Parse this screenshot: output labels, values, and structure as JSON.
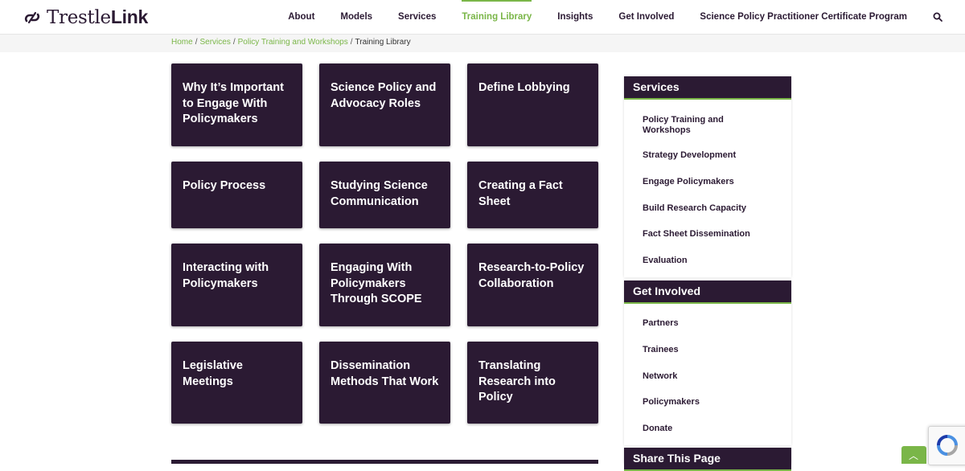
{
  "header": {
    "logo_light": "Trestle",
    "logo_bold": "Link",
    "nav": [
      {
        "label": "About",
        "active": false
      },
      {
        "label": "Models",
        "active": false
      },
      {
        "label": "Services",
        "active": false
      },
      {
        "label": "Training Library",
        "active": true
      },
      {
        "label": "Insights",
        "active": false
      },
      {
        "label": "Get Involved",
        "active": false
      },
      {
        "label": "Science Policy Practitioner Certificate Program",
        "active": false
      }
    ],
    "search_icon": "search-icon"
  },
  "breadcrumb": {
    "items": [
      "Home",
      "Services",
      "Policy Training and Workshops"
    ],
    "current": "Training Library",
    "separator": "/"
  },
  "tiles": [
    "Why It’s Important to Engage With Policymakers",
    "Science Policy and Advocacy Roles",
    "Define Lobbying",
    "Policy Process",
    "Studying Science Communication",
    "Creating a Fact Sheet",
    "Interacting with Policymakers",
    "Engaging With Policymakers Through SCOPE",
    "Research-to-Policy Collaboration",
    "Legislative Meetings",
    "Dissemination Methods That Work",
    "Translating Research into Policy"
  ],
  "sidebar": {
    "services": {
      "title": "Services",
      "links": [
        "Policy Training and Workshops",
        "Strategy Development",
        "Engage Policymakers",
        "Build Research Capacity",
        "Fact Sheet Dissemination",
        "Evaluation"
      ]
    },
    "get_involved": {
      "title": "Get Involved",
      "links": [
        "Partners",
        "Trainees",
        "Network",
        "Policymakers",
        "Donate"
      ]
    },
    "share": {
      "title": "Share This Page"
    }
  },
  "colors": {
    "brand_dark": "#2b1a33",
    "accent_green": "#7ab648",
    "band_gray": "#f5f5f5"
  },
  "widgets": {
    "back_to_top_icon": "chevron-up-icon",
    "recaptcha_icon": "recaptcha-icon"
  }
}
